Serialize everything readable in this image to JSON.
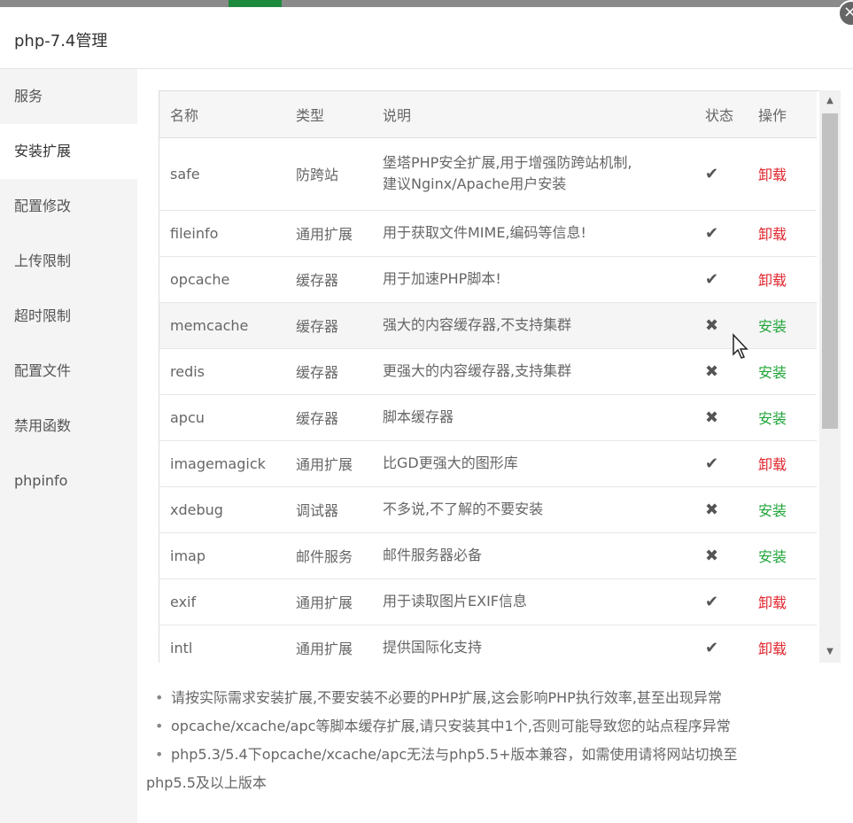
{
  "window": {
    "title": "php-7.4管理"
  },
  "sidebar": {
    "items": [
      {
        "label": "服务"
      },
      {
        "label": "安装扩展",
        "active": true
      },
      {
        "label": "配置修改"
      },
      {
        "label": "上传限制"
      },
      {
        "label": "超时限制"
      },
      {
        "label": "配置文件"
      },
      {
        "label": "禁用函数"
      },
      {
        "label": "phpinfo"
      }
    ]
  },
  "table": {
    "headers": {
      "name": "名称",
      "type": "类型",
      "desc": "说明",
      "state": "状态",
      "op": "操作"
    },
    "rows": [
      {
        "name": "safe",
        "type": "防跨站",
        "desc": "堡塔PHP安全扩展,用于增强防跨站机制,",
        "desc2": "建议Nginx/Apache用户安装",
        "state": "✔",
        "installed": true,
        "op": "卸载"
      },
      {
        "name": "fileinfo",
        "type": "通用扩展",
        "desc": "用于获取文件MIME,编码等信息!",
        "state": "✔",
        "installed": true,
        "op": "卸载"
      },
      {
        "name": "opcache",
        "type": "缓存器",
        "desc": "用于加速PHP脚本!",
        "state": "✔",
        "installed": true,
        "op": "卸载"
      },
      {
        "name": "memcache",
        "type": "缓存器",
        "desc": "强大的内容缓存器,不支持集群",
        "state": "✖",
        "installed": false,
        "op": "安装"
      },
      {
        "name": "redis",
        "type": "缓存器",
        "desc": "更强大的内容缓存器,支持集群",
        "state": "✖",
        "installed": false,
        "op": "安装"
      },
      {
        "name": "apcu",
        "type": "缓存器",
        "desc": "脚本缓存器",
        "state": "✖",
        "installed": false,
        "op": "安装"
      },
      {
        "name": "imagemagick",
        "type": "通用扩展",
        "desc": "比GD更强大的图形库",
        "state": "✔",
        "installed": true,
        "op": "卸载"
      },
      {
        "name": "xdebug",
        "type": "调试器",
        "desc": "不多说,不了解的不要安装",
        "state": "✖",
        "installed": false,
        "op": "安装"
      },
      {
        "name": "imap",
        "type": "邮件服务",
        "desc": "邮件服务器必备",
        "state": "✖",
        "installed": false,
        "op": "安装"
      },
      {
        "name": "exif",
        "type": "通用扩展",
        "desc": "用于读取图片EXIF信息",
        "state": "✔",
        "installed": true,
        "op": "卸载"
      },
      {
        "name": "intl",
        "type": "通用扩展",
        "desc": "提供国际化支持",
        "state": "✔",
        "installed": true,
        "op": "卸载"
      }
    ]
  },
  "notes": [
    "请按实际需求安装扩展,不要安装不必要的PHP扩展,这会影响PHP执行效率,甚至出现异常",
    "opcache/xcache/apc等脚本缓存扩展,请只安装其中1个,否则可能导致您的站点程序异常",
    "php5.3/5.4下opcache/xcache/apc无法与php5.5+版本兼容，如需使用请将网站切换至",
    "php5.5及以上版本"
  ],
  "icons": {
    "close": "close-icon",
    "check": "check-icon",
    "cross": "cross-icon",
    "cursor": "mouse-pointer-icon"
  },
  "colors": {
    "install": "#20a53a",
    "uninstall": "#e0262e",
    "sidebar_bg": "#f4f4f4"
  }
}
